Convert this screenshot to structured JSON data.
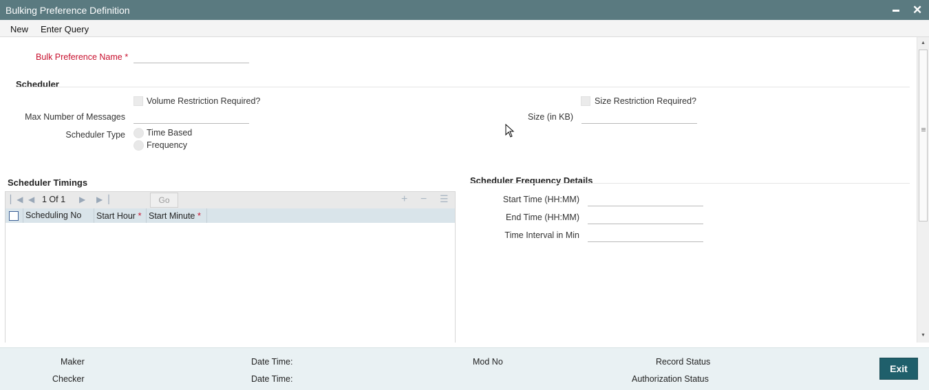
{
  "window": {
    "title": "Bulking Preference Definition"
  },
  "menu": {
    "new": "New",
    "enter_query": "Enter Query"
  },
  "form": {
    "bulk_pref_name_label": "Bulk Preference Name",
    "bulk_pref_name_value": "",
    "required_mark": "*"
  },
  "scheduler": {
    "header": "Scheduler",
    "volume_restriction_label": "Volume Restriction Required?",
    "volume_restriction_checked": false,
    "size_restriction_label": "Size Restriction Required?",
    "size_restriction_checked": false,
    "max_messages_label": "Max Number of Messages",
    "max_messages_value": "",
    "size_kb_label": "Size (in KB)",
    "size_kb_value": "",
    "type_label": "Scheduler Type",
    "type_options": [
      "Time Based",
      "Frequency"
    ]
  },
  "timings": {
    "header": "Scheduler Timings",
    "pagination": "1 Of 1",
    "go_label": "Go",
    "columns": [
      "Scheduling No",
      "Start Hour",
      "Start Minute"
    ],
    "rows": []
  },
  "frequency": {
    "header": "Scheduler Frequency Details",
    "start_time_label": "Start Time (HH:MM)",
    "end_time_label": "End Time (HH:MM)",
    "interval_label": "Time Interval in Min"
  },
  "footer": {
    "maker": "Maker",
    "checker": "Checker",
    "date_time_1": "Date Time:",
    "date_time_2": "Date Time:",
    "mod_no": "Mod No",
    "record_status": "Record Status",
    "authorization_status": "Authorization Status",
    "exit": "Exit"
  },
  "colors": {
    "titlebar": "#5a7a80",
    "accent": "#1f5f6b",
    "required": "#c8102e",
    "grid_header": "#d9e4ea"
  }
}
